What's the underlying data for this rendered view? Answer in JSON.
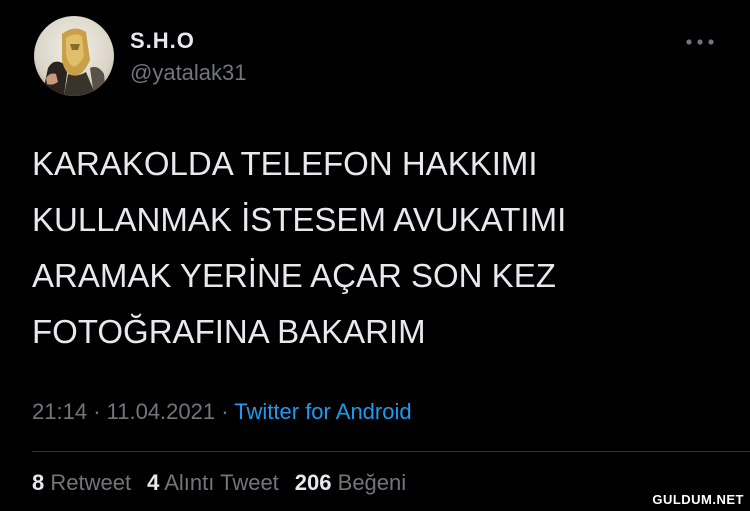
{
  "author": {
    "display_name": "S.H.O",
    "handle": "@yatalak31"
  },
  "more_icon": "more-horizontal-icon",
  "tweet": {
    "lines": [
      "KARAKOLDA TELEFON HAKKIMI",
      "KULLANMAK İSTESEM AVUKATIMI",
      "ARAMAK YERİNE AÇAR SON KEZ",
      "FOTOĞRAFINA BAKARIM"
    ]
  },
  "meta": {
    "time": "21:14",
    "separator": "·",
    "date": "11.04.2021",
    "source": "Twitter for Android"
  },
  "stats": {
    "retweets_count": "8",
    "retweets_label": "Retweet",
    "quotes_count": "4",
    "quotes_label": "Alıntı Tweet",
    "likes_count": "206",
    "likes_label": "Beğeni"
  },
  "watermark": "GULDUM.NET",
  "colors": {
    "background": "#000000",
    "text": "#e7e9ea",
    "secondary": "#71767b",
    "link": "#1d9bf0",
    "divider": "#2f3336"
  }
}
